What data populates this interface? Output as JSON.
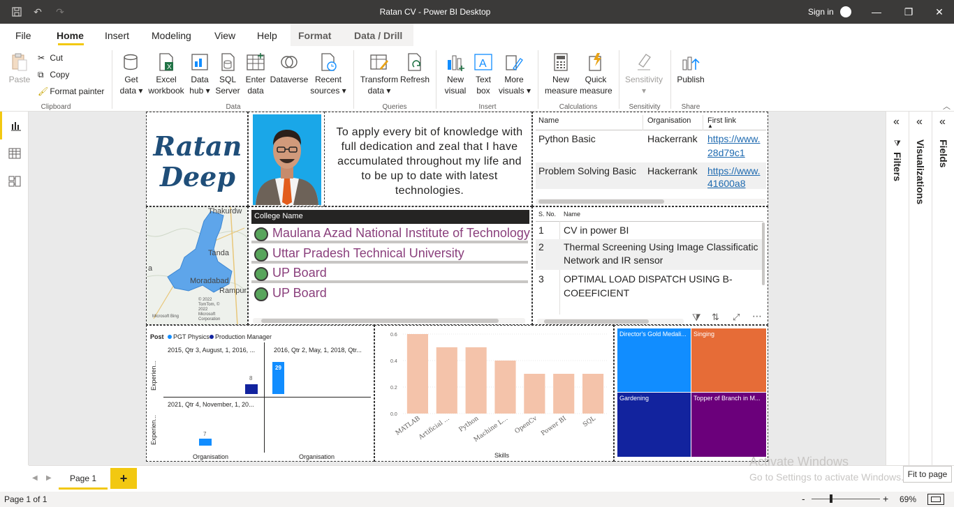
{
  "window": {
    "title": "Ratan CV - Power BI Desktop",
    "sign_in": "Sign in"
  },
  "menu": {
    "tabs": [
      "File",
      "Home",
      "Insert",
      "Modeling",
      "View",
      "Help",
      "Format",
      "Data / Drill"
    ]
  },
  "ribbon": {
    "clipboard": {
      "paste": "Paste",
      "cut": "Cut",
      "copy": "Copy",
      "format_painter": "Format painter",
      "label": "Clipboard"
    },
    "data": {
      "get_data": [
        "Get",
        "data"
      ],
      "excel": [
        "Excel",
        "workbook"
      ],
      "data_hub": [
        "Data",
        "hub"
      ],
      "sql": [
        "SQL",
        "Server"
      ],
      "enter": [
        "Enter",
        "data"
      ],
      "dataverse": "Dataverse",
      "recent": [
        "Recent",
        "sources"
      ],
      "label": "Data"
    },
    "queries": {
      "transform": [
        "Transform",
        "data"
      ],
      "refresh": "Refresh",
      "label": "Queries"
    },
    "insert": {
      "new_visual": [
        "New",
        "visual"
      ],
      "text_box": [
        "Text",
        "box"
      ],
      "more_visuals": [
        "More",
        "visuals"
      ],
      "label": "Insert"
    },
    "calculations": {
      "new_measure": [
        "New",
        "measure"
      ],
      "quick_measure": [
        "Quick",
        "measure"
      ],
      "label": "Calculations"
    },
    "sensitivity": {
      "button": "Sensitivity",
      "label": "Sensitivity"
    },
    "share": {
      "publish": "Publish",
      "label": "Share"
    }
  },
  "report": {
    "name": [
      "Ratan",
      "Deep"
    ],
    "objective": "To apply every bit of knowledge with full dedication and zeal that I have accumulated throughout my life and to be up to date with latest technologies.",
    "certifications": {
      "headers": [
        "Name",
        "Organisation",
        "First link"
      ],
      "rows": [
        {
          "name": "Python Basic",
          "org": "Hackerrank",
          "link1": "https://www.",
          "link2": "28d79c1"
        },
        {
          "name": "Problem Solving Basic",
          "org": "Hackerrank",
          "link1": "https://www.",
          "link2": "41600a8"
        }
      ]
    },
    "map": {
      "labels": [
        "Thakurdw",
        "Tanda",
        "Moradabad",
        "Rampur",
        "a",
        "© 2022 TomTom, © 2022 Microsoft Corporation",
        "Microsoft Bing"
      ]
    },
    "colleges": {
      "header": "College Name",
      "rows": [
        "Maulana Azad National Institute of Technology",
        "Uttar Pradesh Technical University",
        "UP Board",
        "UP Board"
      ]
    },
    "projects": {
      "headers": [
        "S. No.",
        "Name"
      ],
      "rows": [
        {
          "n": "1",
          "l1": "CV in power BI",
          "l2": ""
        },
        {
          "n": "2",
          "l1": "Thermal Screening Using Image Classificatic",
          "l2": "Network and IR sensor"
        },
        {
          "n": "3",
          "l1": "OPTIMAL LOAD DISPATCH USING B-",
          "l2": "COEEFICIENT"
        }
      ]
    },
    "experience_chart": {
      "legend_title": "Post",
      "legend": [
        {
          "name": "PGT Physics",
          "color": "#118dff"
        },
        {
          "name": "Production Manager",
          "color": "#12239e"
        }
      ],
      "panels": [
        {
          "title": "2015, Qtr 3, August, 1, 2016, ...",
          "value": 8,
          "color": "#12239e"
        },
        {
          "title": "2016, Qtr 2, May, 1, 2018, Qtr...",
          "value": 29,
          "color": "#118dff"
        },
        {
          "title": "2021, Qtr 4, November, 1, 20...",
          "value": 7,
          "color": "#118dff"
        }
      ],
      "y_label": "Experien...",
      "x_label": "Organisation"
    },
    "skills_chart": {
      "xlabel": "Skills",
      "ticks": [
        "0.0",
        "0.2",
        "0.4",
        "0.6"
      ]
    },
    "awards": [
      {
        "label": "Director's Gold Medali...",
        "color": "#118dff"
      },
      {
        "label": "Singing",
        "color": "#e66c37"
      },
      {
        "label": "Gardening",
        "color": "#12239e"
      },
      {
        "label": "Topper of Branch in M...",
        "color": "#6b007b"
      }
    ]
  },
  "chart_data": {
    "type": "bar",
    "categories": [
      "MATLAB",
      "Artificial ...",
      "Python",
      "Machine L...",
      "OpenCv",
      "Power BI",
      "SQL"
    ],
    "values": [
      0.6,
      0.5,
      0.5,
      0.4,
      0.3,
      0.3,
      0.3
    ],
    "xlabel": "Skills",
    "ylabel": "",
    "ylim": [
      0,
      0.6
    ],
    "color": "#f4c3aa"
  },
  "panes": {
    "filters": "Filters",
    "visualizations": "Visualizations",
    "fields": "Fields"
  },
  "pages": {
    "tab": "Page 1",
    "add": "+"
  },
  "status": {
    "page": "Page 1 of 1",
    "zoom": "69%",
    "fit_tooltip": "Fit to page"
  },
  "watermark": {
    "line1": "Activate Windows",
    "line2": "Go to Settings to activate Windows."
  }
}
